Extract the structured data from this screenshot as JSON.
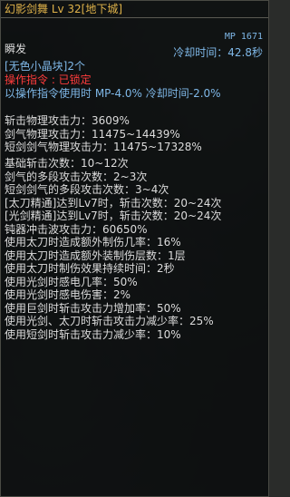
{
  "skill": {
    "title": "幻影剑舞 Lv 32[地下城]",
    "mp": "MP 1671",
    "cooldown": "冷却时间：42.8秒",
    "cast_type": "瞬发",
    "material": "[无色小晶块]2个",
    "command_label": "操作指令 : 已锁定",
    "command_bonus": "以操作指令使用时 MP-4.0% 冷却时间-2.0%"
  },
  "stats": [
    "斩击物理攻击力：3609%",
    "剑气物理攻击力：11475~14439%",
    "短剑剑气物理攻击力：11475~17328%",
    "",
    "基础斩击次数：10~12次",
    "剑气的多段攻击次数：2~3次",
    "短剑剑气的多段攻击次数：3~4次",
    "[太刀精通]达到Lv7时，斩击次数：20~24次",
    "[光剑精通]达到Lv7时，斩击次数：20~24次",
    "钝器冲击波攻击力：60650%",
    "使用太刀时造成额外制伤几率：16%",
    "使用太刀时造成额外装制伤层数：1层",
    "使用太刀时制伤效果持续时间：2秒",
    "使用光剑时感电几率：50%",
    "使用光剑时感电伤害：2%",
    "使用巨剑时斩击攻击力增加率：50%",
    "使用光剑、太刀时斩击攻击力减少率：25%",
    "使用短剑时斩击攻击力减少率：10%"
  ]
}
